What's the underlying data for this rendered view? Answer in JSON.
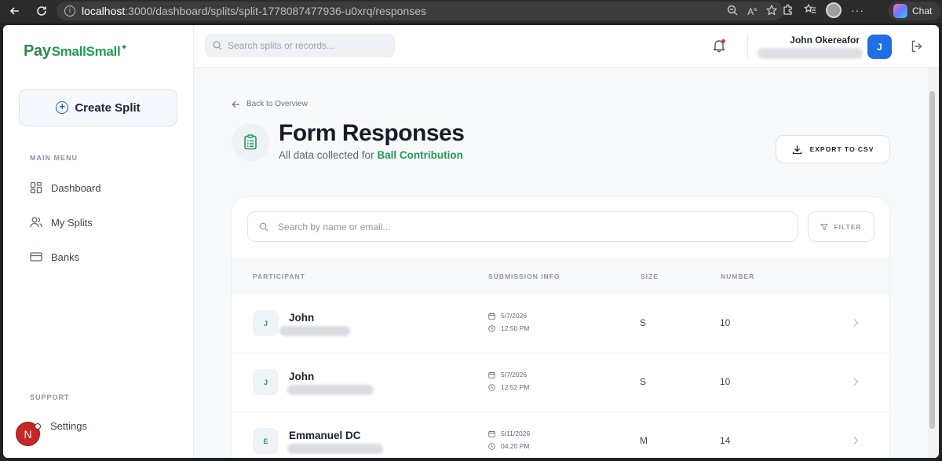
{
  "browser": {
    "url_host": "localhost",
    "url_path": ":3000/dashboard/splits/split-1778087477936-u0xrq/responses",
    "chat_label": "Chat"
  },
  "sidebar": {
    "logo_text_pay": "Pay",
    "logo_text_small": "SmallSmall",
    "create_split_label": "Create Split",
    "main_menu_label": "MAIN MENU",
    "items": [
      {
        "label": "Dashboard",
        "icon": "dashboard-icon"
      },
      {
        "label": "My Splits",
        "icon": "users-icon"
      },
      {
        "label": "Banks",
        "icon": "card-icon"
      }
    ],
    "support_label": "SUPPORT",
    "settings_label": "Settings",
    "avatar_letter": "N"
  },
  "header": {
    "search_placeholder": "Search splits or records...",
    "user_name": "John Okereafor",
    "user_initial": "J"
  },
  "main": {
    "back_label": "Back to Overview",
    "title": "Form Responses",
    "subtitle_prefix": "All data collected for",
    "subtitle_highlight": "Ball Contribution",
    "export_label": "EXPORT TO CSV",
    "table_search_placeholder": "Search by name or email...",
    "filter_label": "FILTER",
    "columns": [
      "PARTICIPANT",
      "SUBMISSION INFO",
      "SIZE",
      "NUMBER"
    ],
    "rows": [
      {
        "initial": "J",
        "name": "John",
        "date": "5/7/2026",
        "time": "12:50 PM",
        "size": "S",
        "number": "10"
      },
      {
        "initial": "J",
        "name": "John",
        "date": "5/7/2026",
        "time": "12:52 PM",
        "size": "S",
        "number": "10"
      },
      {
        "initial": "E",
        "name": "Emmanuel DC",
        "date": "5/11/2026",
        "time": "04:20 PM",
        "size": "M",
        "number": "14"
      }
    ]
  },
  "colors": {
    "brand_green": "#1f9d55",
    "primary_blue": "#1f6fe5",
    "text_dark": "#131c27"
  }
}
